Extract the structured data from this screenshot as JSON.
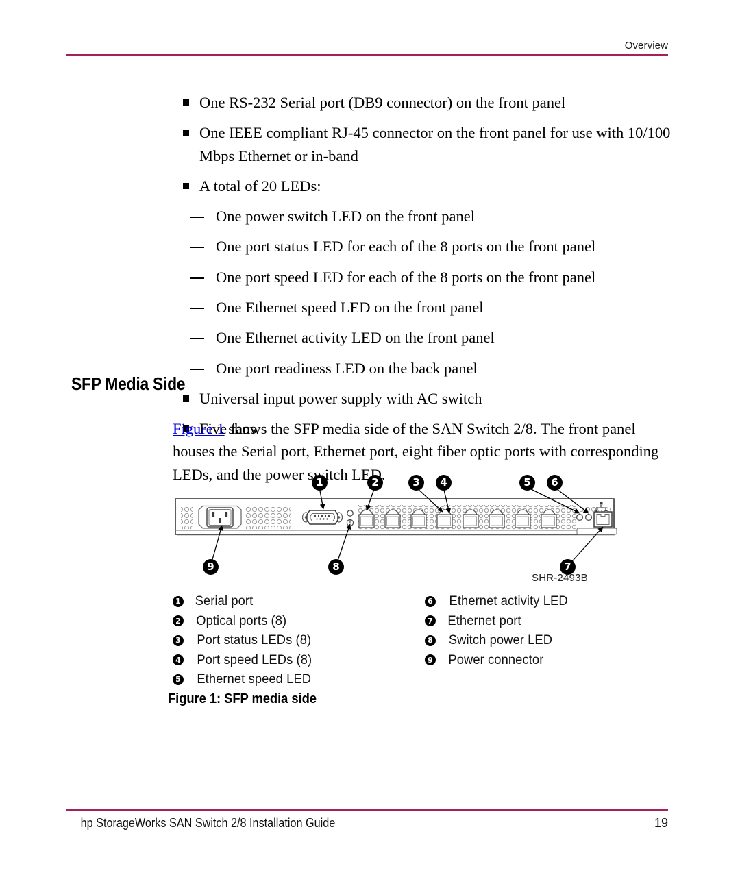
{
  "header": {
    "running_head": "Overview",
    "rule_color": "#a4215c"
  },
  "features": {
    "bullets": [
      "One RS-232 Serial port (DB9 connector) on the front panel",
      "One IEEE compliant RJ-45 connector on the front panel for use with 10/100 Mbps Ethernet or in-band",
      "A total of 20 LEDs:"
    ],
    "sub_items": [
      "One power switch LED on the front panel",
      "One port status LED for each of the 8 ports on the front panel",
      "One port speed LED for each of the 8 ports on the front panel",
      "One Ethernet speed LED on the front panel",
      "One Ethernet activity LED on the front panel",
      "One port readiness LED on the back panel"
    ],
    "bullets_tail": [
      "Universal input power supply with AC switch",
      "Five fans"
    ]
  },
  "section": {
    "heading": "SFP Media Side",
    "paragraph_link": "Figure 1",
    "paragraph_rest": " shows the SFP media side of the SAN Switch 2/8. The front panel houses the Serial port, Ethernet port, eight fiber optic ports with corresponding LEDs, and the power switch LED.",
    "link_color": "#0000dd"
  },
  "figure": {
    "drawing_code": "SHR-2493B",
    "caption": "Figure 1:  SFP media side",
    "callouts": [
      {
        "num": "1",
        "label": "Serial port"
      },
      {
        "num": "2",
        "label": "Optical ports (8)"
      },
      {
        "num": "3",
        "label": "Port status LEDs (8)"
      },
      {
        "num": "4",
        "label": "Port speed LEDs (8)"
      },
      {
        "num": "5",
        "label": "Ethernet speed LED"
      },
      {
        "num": "6",
        "label": "Ethernet activity LED"
      },
      {
        "num": "7",
        "label": "Ethernet port"
      },
      {
        "num": "8",
        "label": "Switch power LED"
      },
      {
        "num": "9",
        "label": "Power connector"
      }
    ],
    "legend_left": [
      {
        "num": "❶",
        "label": "Serial port"
      },
      {
        "num": "❷",
        "label": "Optical ports (8)"
      },
      {
        "num": "❸",
        "label": "Port status LEDs (8)"
      },
      {
        "num": "❹",
        "label": "Port speed LEDs (8)"
      },
      {
        "num": "❺",
        "label": "Ethernet speed LED"
      }
    ],
    "legend_right": [
      {
        "num": "❻",
        "label": "Ethernet activity LED"
      },
      {
        "num": "❼",
        "label": "Ethernet port"
      },
      {
        "num": "❽",
        "label": "Switch power LED"
      },
      {
        "num": "❾",
        "label": "Power connector"
      }
    ]
  },
  "footer": {
    "title": "hp StorageWorks SAN Switch 2/8 Installation Guide",
    "page_number": "19"
  }
}
